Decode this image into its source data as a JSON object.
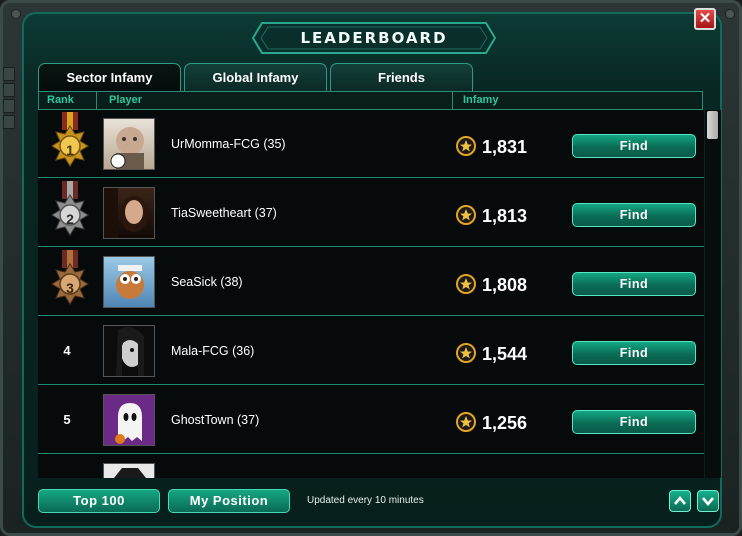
{
  "window": {
    "title": "LEADERBOARD",
    "close_label": "✕"
  },
  "tabs": [
    {
      "label": "Sector Infamy",
      "active": true
    },
    {
      "label": "Global Infamy",
      "active": false
    },
    {
      "label": "Friends",
      "active": false
    }
  ],
  "columns": {
    "rank": "Rank",
    "player": "Player",
    "infamy": "Infamy"
  },
  "rows": [
    {
      "rank": "1",
      "medal": "gold",
      "player": "UrMomma-FCG (35)",
      "infamy": "1,831",
      "find_label": "Find"
    },
    {
      "rank": "2",
      "medal": "silver",
      "player": "TiaSweetheart (37)",
      "infamy": "1,813",
      "find_label": "Find"
    },
    {
      "rank": "3",
      "medal": "bronze",
      "player": "SeaSick (38)",
      "infamy": "1,808",
      "find_label": "Find"
    },
    {
      "rank": "4",
      "medal": "none",
      "player": "Mala-FCG (36)",
      "infamy": "1,544",
      "find_label": "Find"
    },
    {
      "rank": "5",
      "medal": "none",
      "player": "GhostTown (37)",
      "infamy": "1,256",
      "find_label": "Find"
    }
  ],
  "footer": {
    "top100_label": "Top 100",
    "my_position_label": "My Position",
    "updated_text": "Updated every 10 minutes"
  },
  "icons": {
    "close": "close-icon",
    "infamy": "star-shield-icon",
    "medal": "medal-icon",
    "scroll_up": "chevron-up-icon",
    "scroll_down": "chevron-down-icon"
  },
  "colors": {
    "accent": "#0f6b5a",
    "button": "#0b6c56",
    "header_text": "#2bc79d",
    "gold": "#d9a520",
    "silver": "#a8a8a8",
    "bronze": "#b0703a",
    "close": "#c21e1e"
  }
}
